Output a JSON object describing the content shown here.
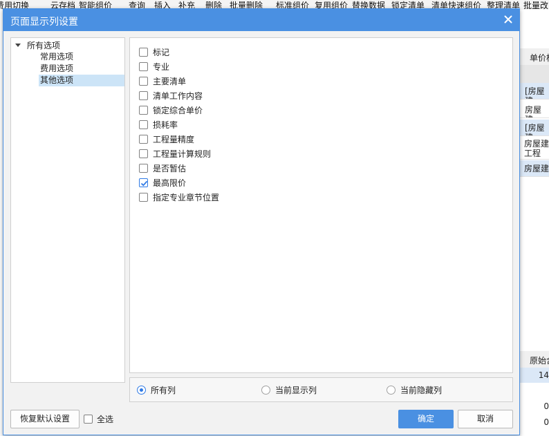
{
  "background": {
    "toolbar_items": [
      "费用切换",
      "云存档",
      "智能组价",
      "查询",
      "插入",
      "补充",
      "删除",
      "批量删除",
      "标准组价",
      "复用组价",
      "替换数据",
      "锁定清单",
      "清单快速组价",
      "整理清单",
      "批量改"
    ],
    "grid_header": "单价构",
    "grid_cells": [
      "[房屋建",
      "房屋建",
      "[房屋建",
      "房屋建\n工程",
      "房屋建"
    ],
    "lower_header": "原始含",
    "lower_values": [
      "14",
      "0",
      "0"
    ]
  },
  "dialog": {
    "title": "页面显示列设置",
    "tree": {
      "root": "所有选项",
      "children": [
        "常用选项",
        "费用选项",
        "其他选项"
      ],
      "selected_index": 2
    },
    "options": [
      {
        "label": "标记",
        "checked": false
      },
      {
        "label": "专业",
        "checked": false
      },
      {
        "label": "主要清单",
        "checked": false
      },
      {
        "label": "清单工作内容",
        "checked": false
      },
      {
        "label": "锁定综合单价",
        "checked": false
      },
      {
        "label": "损耗率",
        "checked": false
      },
      {
        "label": "工程量精度",
        "checked": false
      },
      {
        "label": "工程量计算规则",
        "checked": false
      },
      {
        "label": "是否暂估",
        "checked": false
      },
      {
        "label": "最高限价",
        "checked": true
      },
      {
        "label": "指定专业章节位置",
        "checked": false
      }
    ],
    "radios": [
      {
        "label": "所有列",
        "selected": true
      },
      {
        "label": "当前显示列",
        "selected": false
      },
      {
        "label": "当前隐藏列",
        "selected": false
      }
    ],
    "restore_button": "恢复默认设置",
    "select_all": {
      "label": "全选",
      "checked": false
    },
    "ok_button": "确定",
    "cancel_button": "取消",
    "accent_color": "#4a90e2"
  }
}
